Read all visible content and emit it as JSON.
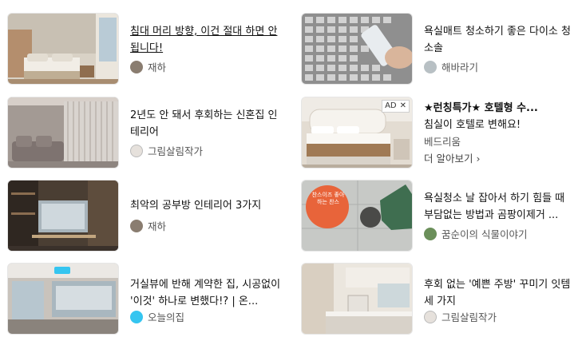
{
  "left": [
    {
      "title": "침대 머리 방향, 이건 절대 하면 안 됩니다!",
      "author": "재하",
      "underlined": true
    },
    {
      "title": "2년도 안 돼서 후회하는 신혼집 인테리어",
      "author": "그림살림작가"
    },
    {
      "title": "최악의 공부방 인테리어 3가지",
      "author": "재하"
    },
    {
      "title": "거실뷰에 반해 계약한 집, 시공없이 '이것' 하나로 변했다!? | 온...",
      "author": "오늘의집"
    }
  ],
  "right": [
    {
      "title": "욕실매트 청소하기 좋은 다이소 청소솔",
      "author": "해바라기"
    },
    {
      "title": "★런칭특가★ 호텔형 수...",
      "subtitle": "침실이 호텔로 변해요!",
      "advertiser": "베드리움",
      "learn_more": "더 알아보기 ›",
      "ad_label": "AD",
      "ad_close": "✕"
    },
    {
      "title": "욕실청소 날 잡아서 하기 힘들 때 부담없는 방법과 곰팡이제거 ...",
      "author": "꿈순이의 식물이야기",
      "thumb_text": "찬스이즈 좋아하는 찬스"
    },
    {
      "title": "후회 없는 '예쁜 주방' 꾸미기 잇템 세 가지",
      "author": "그림살림작가"
    }
  ]
}
